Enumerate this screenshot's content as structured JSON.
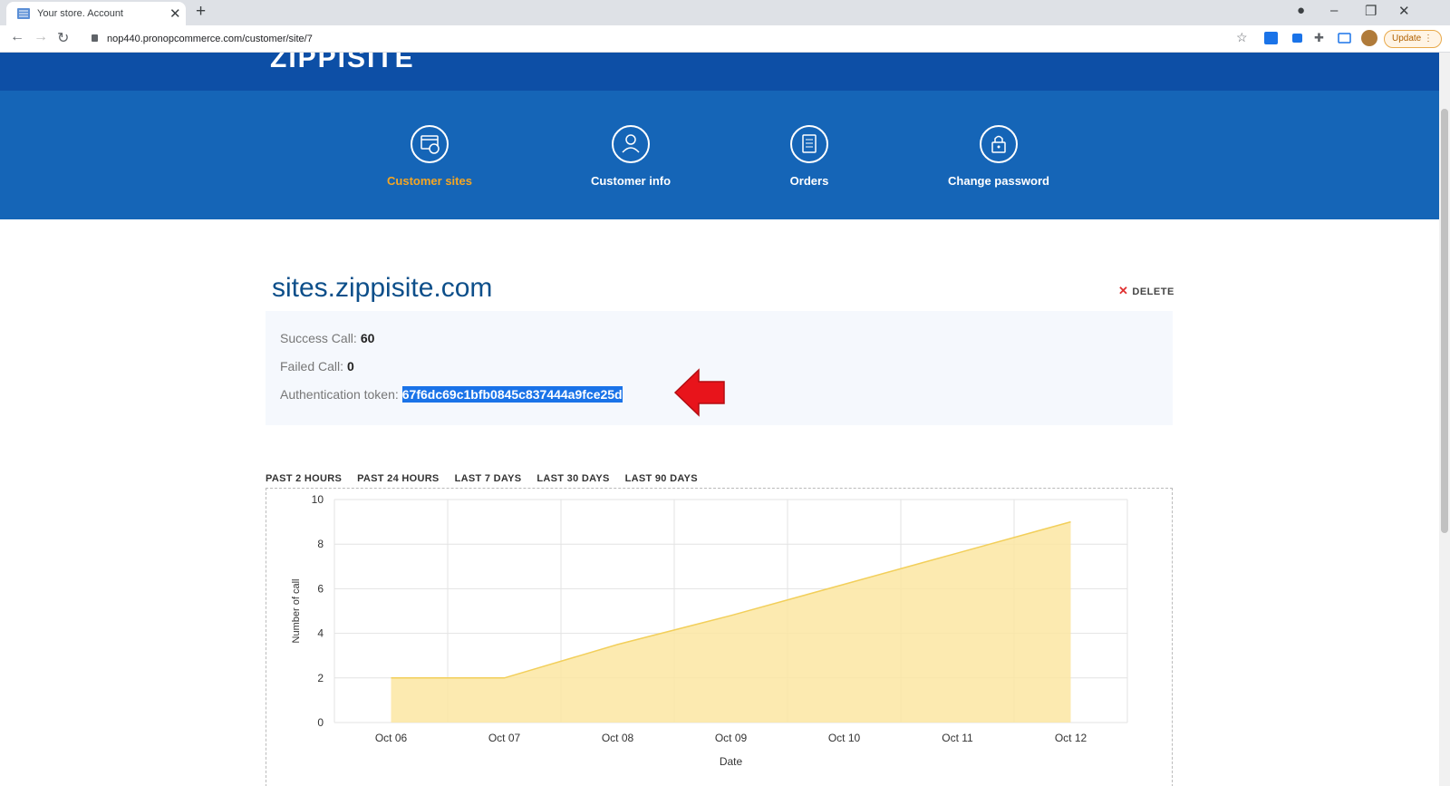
{
  "browser": {
    "tab_title": "Your store. Account",
    "url": "nop440.pronopcommerce.com/customer/site/7",
    "update_label": "Update"
  },
  "header": {
    "logo": "ZIPPISITE",
    "nav": [
      {
        "label": "Customer sites",
        "icon": "globe-window-icon",
        "active": true
      },
      {
        "label": "Customer info",
        "icon": "user-icon",
        "active": false
      },
      {
        "label": "Orders",
        "icon": "document-icon",
        "active": false
      },
      {
        "label": "Change password",
        "icon": "lock-icon",
        "active": false
      }
    ]
  },
  "site": {
    "title": "sites.zippisite.com",
    "delete_label": "DELETE",
    "success_label": "Success Call:",
    "success_value": "60",
    "failed_label": "Failed Call:",
    "failed_value": "0",
    "token_label": "Authentication token:",
    "token_value": "67f6dc69c1bfb0845c837444a9fce25d"
  },
  "ranges": [
    "PAST 2 HOURS",
    "PAST 24 HOURS",
    "LAST 7 DAYS",
    "LAST 30 DAYS",
    "LAST 90 DAYS"
  ],
  "colors": {
    "header_dark": "#0d4fa6",
    "header_nav": "#1565b7",
    "active_nav": "#f5a623",
    "area_fill": "#fbe6a2",
    "area_line": "#f2cf5b",
    "arrow": "#e8141b"
  },
  "chart_data": {
    "type": "area",
    "categories": [
      "Oct 06",
      "Oct 07",
      "Oct 08",
      "Oct 09",
      "Oct 10",
      "Oct 11",
      "Oct 12"
    ],
    "values": [
      2,
      2,
      3.5,
      4.8,
      6.2,
      7.6,
      9
    ],
    "xlabel": "Date",
    "ylabel": "Number of call",
    "ylim": [
      0,
      10
    ],
    "yticks": [
      0,
      2,
      4,
      6,
      8,
      10
    ],
    "grid": true
  }
}
